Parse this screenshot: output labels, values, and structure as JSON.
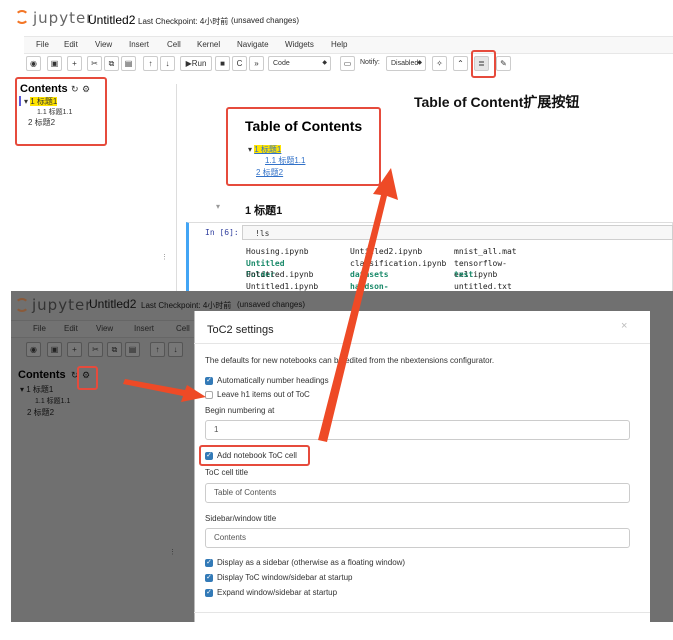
{
  "top": {
    "logo": "jupyter",
    "notebook_name": "Untitled2",
    "checkpoint": "Last Checkpoint: 4小时前",
    "unsaved": "(unsaved changes)",
    "menu": [
      "File",
      "Edit",
      "View",
      "Insert",
      "Cell",
      "Kernel",
      "Navigate",
      "Widgets",
      "Help"
    ],
    "toolbar": {
      "run_label": "Run",
      "cell_type": "Code",
      "notify_label": "Notify:",
      "notify_value": "Disabled"
    }
  },
  "toc_panel": {
    "title": "Contents",
    "items": [
      "1 标题1",
      "1.1 标题1.1",
      "2 标题2"
    ]
  },
  "notebook": {
    "annotation": "Table of Content扩展按钮",
    "toc_cell": {
      "heading": "Table of Contents",
      "items": [
        "1  标题1",
        "1.1  标题1.1",
        "2  标题2"
      ]
    },
    "heading_cell": "1  标题1",
    "prompt": "In [6]:",
    "code": "!ls",
    "output": [
      [
        "Housing.ipynb",
        "Untitled2.ipynb",
        "mnist_all.mat"
      ],
      [
        "Untitled Folder",
        "classification.ipynb",
        "tensorflow-ex1.ipynb"
      ],
      [
        "Untitled.ipynb",
        "datasets",
        "test"
      ],
      [
        "Untitled1.ipynb",
        "handson-ml-master",
        "untitled.txt"
      ]
    ]
  },
  "bottom": {
    "logo": "jupyter",
    "notebook_name": "Untitled2",
    "checkpoint": "Last Checkpoint: 4小时前",
    "unsaved": "(unsaved changes)",
    "menu": [
      "File",
      "Edit",
      "View",
      "Insert",
      "Cell"
    ],
    "toc_title": "Contents",
    "toc_items": [
      "1 标题1",
      "1.1 标题1.1",
      "2 标题2"
    ]
  },
  "modal": {
    "title": "ToC2 settings",
    "close": "×",
    "description": "The defaults for new notebooks can be edited from the nbextensions configurator.",
    "auto_number": "Automatically number headings",
    "leave_h1": "Leave h1 items out of ToC",
    "begin_label": "Begin numbering at",
    "begin_value": "1",
    "add_cell": "Add notebook ToC cell",
    "cell_title_label": "ToC cell title",
    "cell_title_value": "Table of Contents",
    "sidebar_title_label": "Sidebar/window title",
    "sidebar_title_value": "Contents",
    "display_sidebar": "Display as a sidebar (otherwise as a floating window)",
    "display_startup": "Display ToC window/sidebar at startup",
    "expand_startup": "Expand window/sidebar at startup"
  },
  "colors": {
    "annotation_red": "#e64b3c",
    "highlight": "#ffe400",
    "link_blue": "#3171c8",
    "jupyter_orange": "#f37626"
  }
}
